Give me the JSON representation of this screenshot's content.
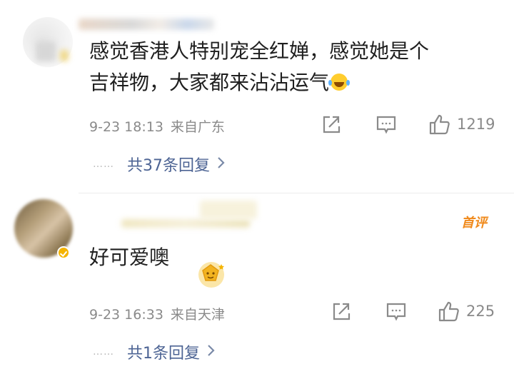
{
  "comments": [
    {
      "text_line1": "感觉香港人特别宠全红婵，感觉她是个",
      "text_line2": "吉祥物，大家都来沾沾运气",
      "emoji": "laughing-tears-icon",
      "time": "9-23 18:13",
      "source": "来自广东",
      "likes": "1219",
      "replies_label": "共37条回复",
      "replies_dots": "……"
    },
    {
      "first_badge": "首评",
      "text": "好可爱噢",
      "sticker": "gold-badge-sticker-icon",
      "time": "9-23 16:33",
      "source": "来自天津",
      "likes": "225",
      "replies_label": "共1条回复",
      "replies_dots": "……"
    }
  ],
  "icons": {
    "share": "share-icon",
    "comment": "comment-icon",
    "like": "thumbs-up-icon",
    "chevron": "chevron-right-icon"
  },
  "colors": {
    "link": "#4d6494",
    "meta": "#8a8a8a",
    "first_badge": "#f08a1c",
    "verified": "#f5b400"
  }
}
